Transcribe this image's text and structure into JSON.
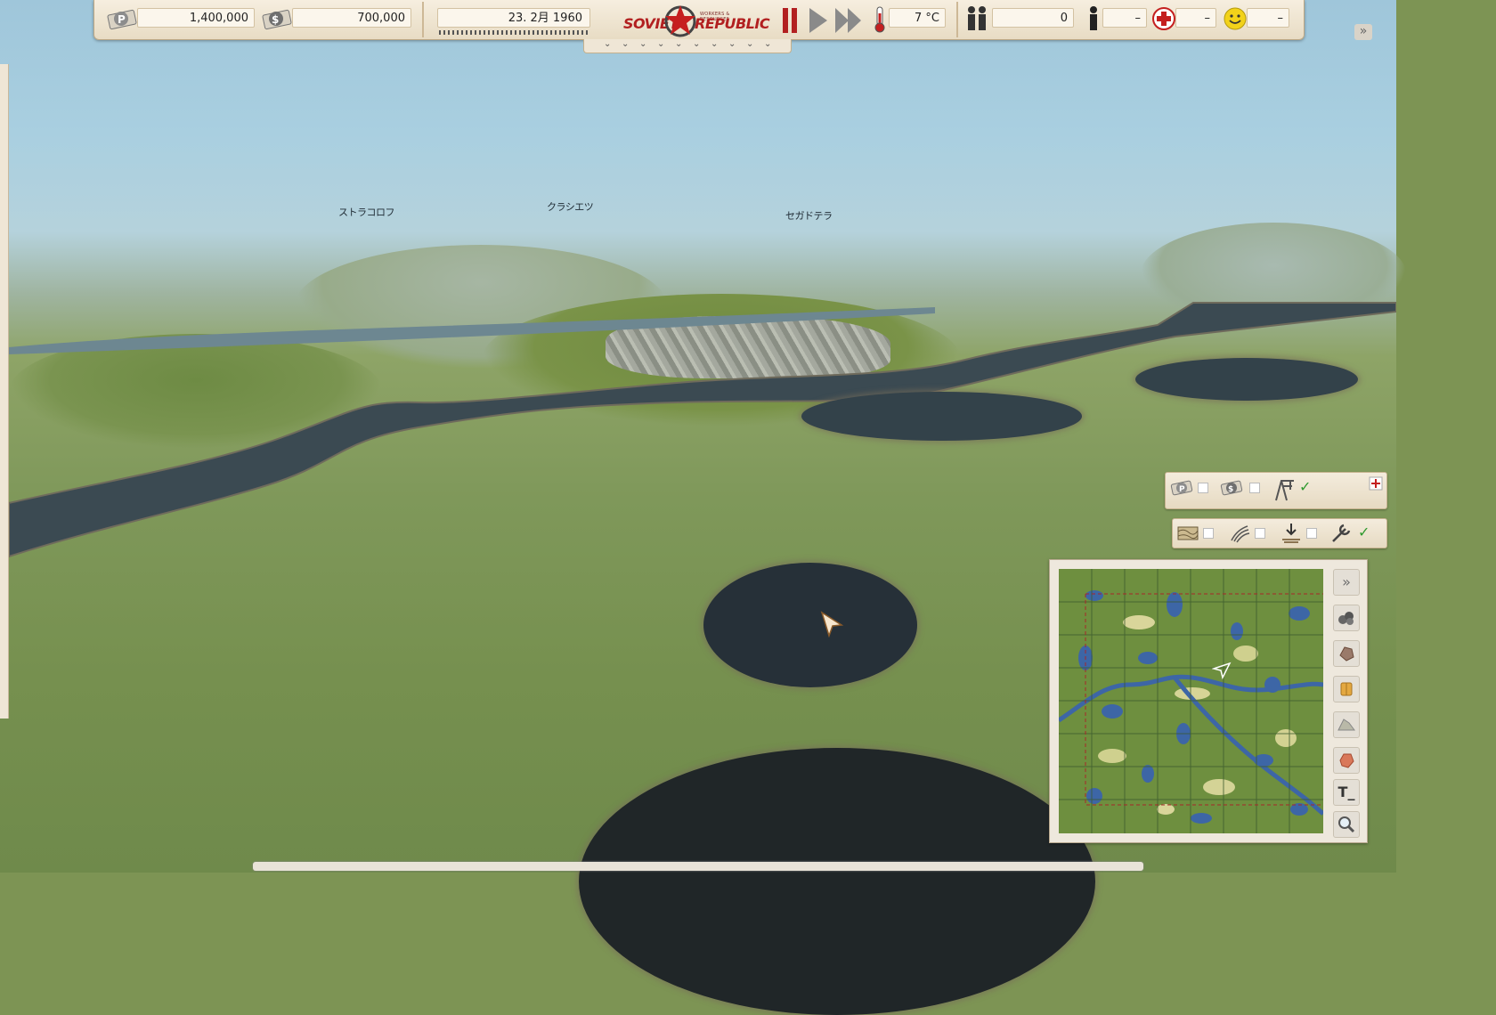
{
  "game_title": {
    "line1": "SOVIET",
    "line2": "REPUBLIC",
    "subtitle": "WORKERS & RESOURCES"
  },
  "top_bar": {
    "rubles": "1,400,000",
    "dollars": "700,000",
    "date": "23. 2月 1960",
    "temperature": "7 °C",
    "workers": "0",
    "population": "–",
    "health": "–",
    "happiness": "–"
  },
  "map_labels": [
    "ストラコロフ",
    "クラシエツ",
    "セガドテラ"
  ],
  "resource_panel": {
    "rubles_checked": false,
    "dollars_checked": false,
    "construction_checked": true
  },
  "terrain_panel": {
    "texture_checked": false,
    "slope_checked": false,
    "dig_checked": false,
    "tools_checked": true
  },
  "minimap_side_buttons": [
    "expand-icon",
    "coal-icon",
    "iron-ore-icon",
    "wood-icon",
    "gravel-icon",
    "bauxite-icon",
    "text-label-icon",
    "zoom-icon"
  ],
  "colors": {
    "bar_bg": "#f6eedf",
    "brand_red": "#b22020",
    "water": "#33424a",
    "grass": "#7d9454"
  }
}
